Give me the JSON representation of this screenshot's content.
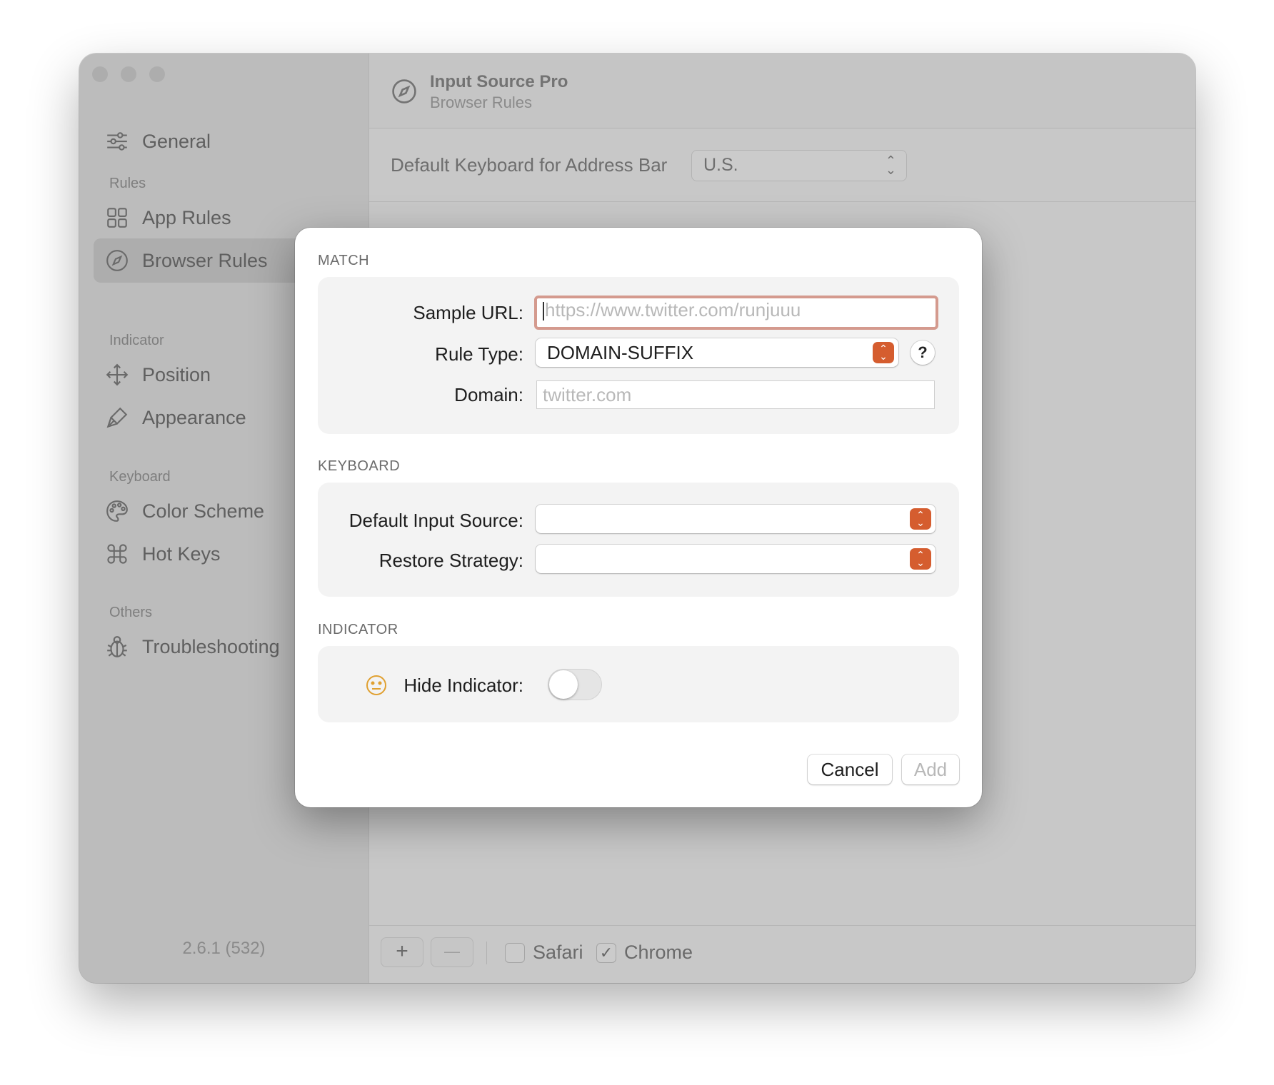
{
  "window": {
    "title": "Input Source Pro",
    "subtitle": "Browser Rules"
  },
  "sidebar": {
    "general": "General",
    "groups": {
      "rules": "Rules",
      "indicator": "Indicator",
      "keyboard": "Keyboard",
      "others": "Others"
    },
    "items": {
      "app_rules": "App Rules",
      "browser_rules": "Browser Rules",
      "position": "Position",
      "appearance": "Appearance",
      "color_scheme": "Color Scheme",
      "hot_keys": "Hot Keys",
      "troubleshooting": "Troubleshooting"
    },
    "selected": "browser_rules",
    "version": "2.6.1 (532)"
  },
  "main": {
    "default_keyboard_label": "Default Keyboard for Address Bar",
    "default_keyboard_value": "U.S.",
    "bottom": {
      "add": "+",
      "remove": "—",
      "safari_label": "Safari",
      "safari_checked": false,
      "chrome_label": "Chrome",
      "chrome_checked": true
    }
  },
  "dialog": {
    "match": {
      "section_title": "MATCH",
      "sample_url_label": "Sample URL:",
      "sample_url_placeholder": "https://www.twitter.com/runjuuu",
      "rule_type_label": "Rule Type:",
      "rule_type_value": "DOMAIN-SUFFIX",
      "help": "?",
      "domain_label": "Domain:",
      "domain_placeholder": "twitter.com"
    },
    "keyboard": {
      "section_title": "KEYBOARD",
      "default_input_source_label": "Default Input Source:",
      "default_input_source_value": "",
      "restore_strategy_label": "Restore Strategy:",
      "restore_strategy_value": ""
    },
    "indicator": {
      "section_title": "INDICATOR",
      "hide_indicator_label": "Hide Indicator:",
      "hide_indicator_on": false
    },
    "buttons": {
      "cancel": "Cancel",
      "add": "Add"
    }
  },
  "colors": {
    "accent": "#d55d2f",
    "focus_ring": "#d49a8e"
  }
}
